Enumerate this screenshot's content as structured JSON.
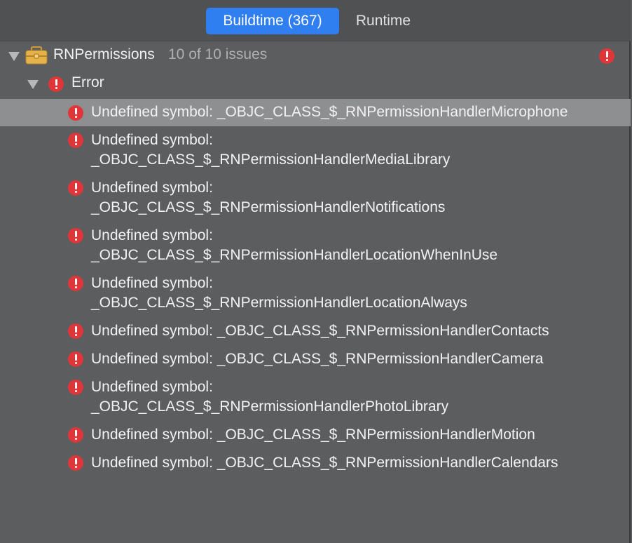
{
  "tabs": [
    {
      "label": "Buildtime (367)",
      "active": true
    },
    {
      "label": "Runtime",
      "active": false
    }
  ],
  "project": {
    "name": "RNPermissions",
    "issue_count": "10 of 10 issues"
  },
  "group": {
    "label": "Error"
  },
  "issues": [
    {
      "line1": "Undefined symbol: _OBJC_CLASS_$_RNPermissionHandlerMicrophone",
      "line2": "",
      "selected": true
    },
    {
      "line1": "Undefined symbol:",
      "line2": "_OBJC_CLASS_$_RNPermissionHandlerMediaLibrary",
      "selected": false
    },
    {
      "line1": "Undefined symbol:",
      "line2": "_OBJC_CLASS_$_RNPermissionHandlerNotifications",
      "selected": false
    },
    {
      "line1": "Undefined symbol:",
      "line2": "_OBJC_CLASS_$_RNPermissionHandlerLocationWhenInUse",
      "selected": false
    },
    {
      "line1": "Undefined symbol:",
      "line2": "_OBJC_CLASS_$_RNPermissionHandlerLocationAlways",
      "selected": false
    },
    {
      "line1": "Undefined symbol: _OBJC_CLASS_$_RNPermissionHandlerContacts",
      "line2": "",
      "selected": false
    },
    {
      "line1": "Undefined symbol: _OBJC_CLASS_$_RNPermissionHandlerCamera",
      "line2": "",
      "selected": false
    },
    {
      "line1": "Undefined symbol:",
      "line2": "_OBJC_CLASS_$_RNPermissionHandlerPhotoLibrary",
      "selected": false
    },
    {
      "line1": "Undefined symbol: _OBJC_CLASS_$_RNPermissionHandlerMotion",
      "line2": "",
      "selected": false
    },
    {
      "line1": "Undefined symbol: _OBJC_CLASS_$_RNPermissionHandlerCalendars",
      "line2": "",
      "selected": false
    }
  ],
  "icons": {
    "project": "toolbox-icon",
    "error": "error-icon",
    "expand": "disclosure-triangle-icon"
  },
  "colors": {
    "accent": "#2f7ff1",
    "error": "#e0363a",
    "selection": "#8e8f91"
  }
}
